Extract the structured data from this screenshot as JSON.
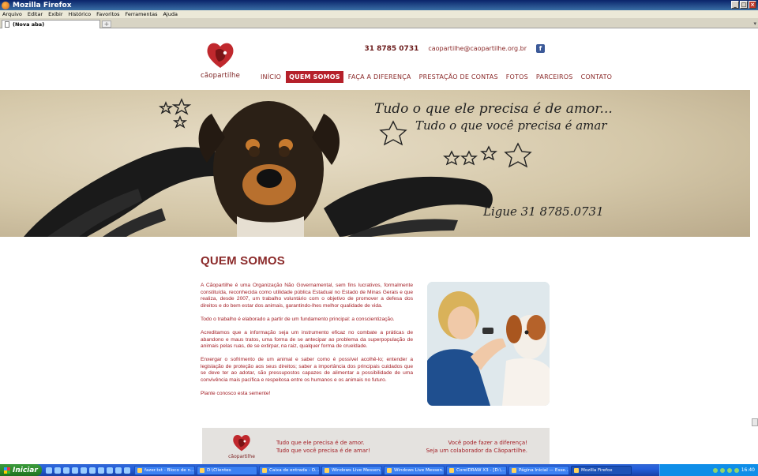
{
  "browser": {
    "window_title": "Mozilla Firefox",
    "menu": [
      "Arquivo",
      "Editar",
      "Exibir",
      "Histórico",
      "Favoritos",
      "Ferramentas",
      "Ajuda"
    ],
    "tab_title": "(Nova aba)",
    "new_tab": "+"
  },
  "site": {
    "logo_text": "cãopartilhe",
    "phone": "31 8785 0731",
    "email": "caopartilhe@caopartilhe.org.br",
    "facebook_icon": "facebook-icon",
    "nav": [
      "INÍCIO",
      "QUEM SOMOS",
      "FAÇA A DIFERENÇA",
      "PRESTAÇÃO DE CONTAS",
      "FOTOS",
      "PARCEIROS",
      "CONTATO"
    ],
    "active_nav": "QUEM SOMOS",
    "accent_color": "#b5202a"
  },
  "banner": {
    "line1": "Tudo o que ele precisa é de amor...",
    "line2": "Tudo o que você precisa é amar",
    "phone_line": "Ligue 31 8785.0731"
  },
  "content": {
    "title": "QUEM SOMOS",
    "paragraphs": [
      "A Cãopartilhe é uma Organização Não Governamental, sem fins lucrativos, formalmente constituída, reconhecida como utilidade pública Estadual no Estado de Minas Gerais e que realiza, desde 2007, um trabalho voluntário com o objetivo de promover a defesa dos direitos e do bem estar dos animais, garantindo-lhes melhor qualidade de vida.",
      "Todo o trabalho é elaborado a partir de um fundamento principal: a conscientização.",
      "Acreditamos que a informação seja um instrumento eficaz no combate a práticas de abandono e maus tratos, uma forma de se antecipar ao problema da superpopulação de animais pelas ruas, de se extirpar, na raiz, qualquer forma de crueldade.",
      "Enxergar o sofrimento de um animal e saber como é possível acolhê-lo; entender a legislação de proteção aos seus direitos; saber a importância dos principais cuidados que se deve ter ao adotar, são pressupostos capazes de alimentar a possibilidade de uma convivência mais pacífica e respeitosa entre os humanos e os animais no futuro.",
      "Plante conosco esta semente!"
    ]
  },
  "footer": {
    "logo_text": "cãopartilhe",
    "left_line1": "Tudo que ele precisa é de amor.",
    "left_line2": "Tudo que você precisa é de amar!",
    "right_line1": "Você pode fazer a diferença!",
    "right_line2": "Seja um colaborador da Cãopartilhe."
  },
  "taskbar": {
    "start": "Iniciar",
    "tasks": [
      "fazer.txt - Bloco de n...",
      "D:\\Clientes",
      "Caixa de entrada - O...",
      "Windows Live Messen...",
      "Windows Live Messen...",
      "CorelDRAW X3 - [D:\\...",
      "Página Inicial — Esse...",
      "Mozilla Firefox"
    ],
    "active_task": "Mozilla Firefox",
    "clock": "16:40"
  }
}
